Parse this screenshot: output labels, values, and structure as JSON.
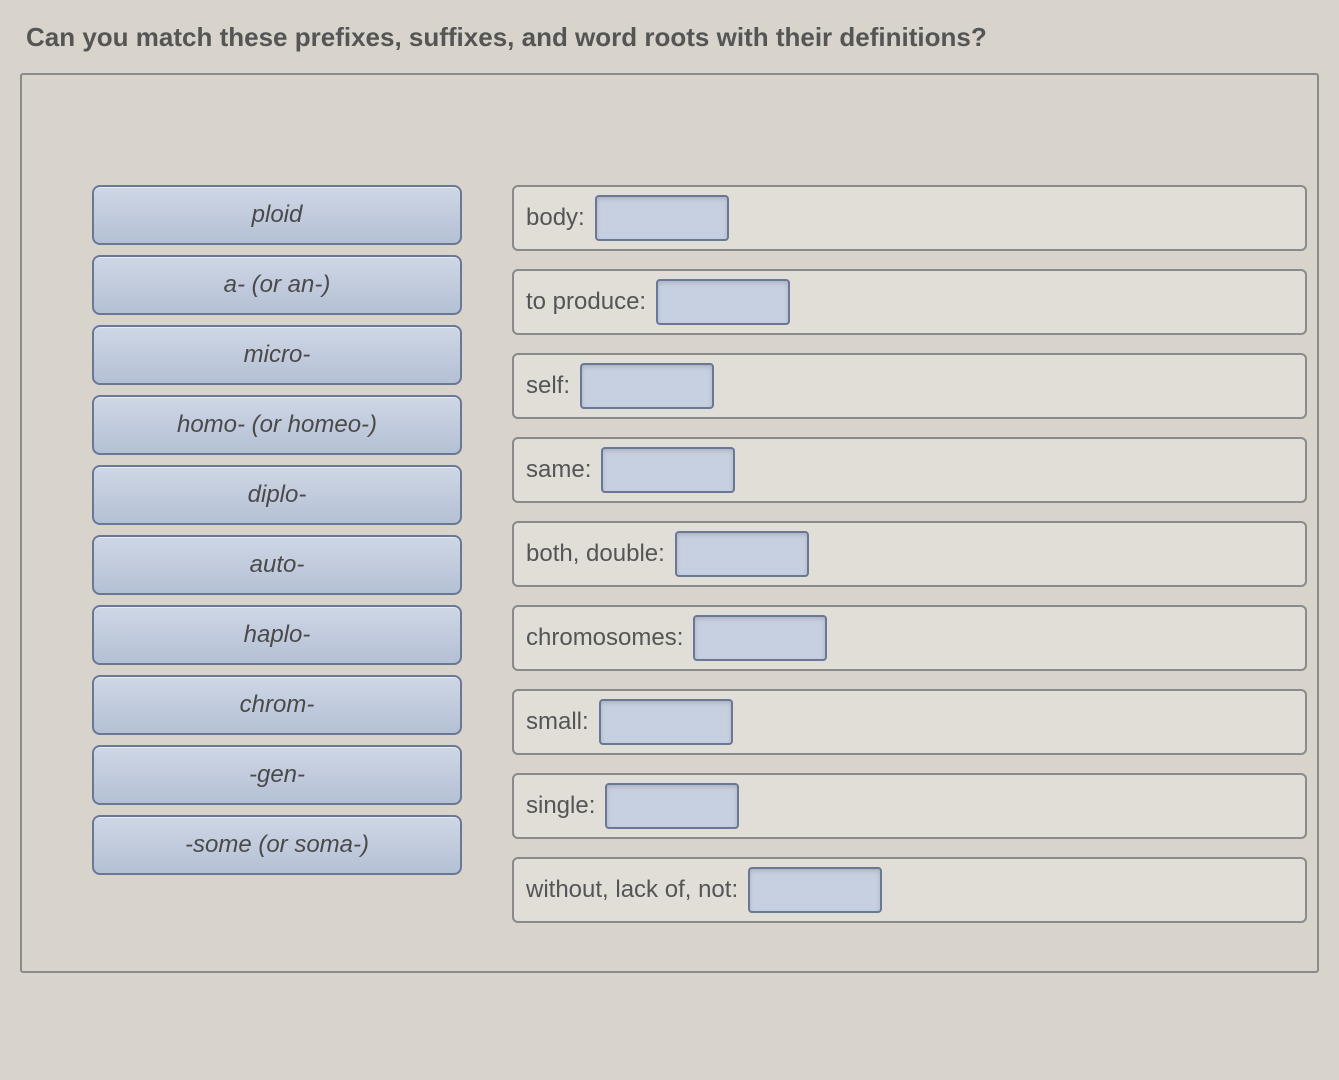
{
  "question": "Can you match these prefixes, suffixes, and word roots with their definitions?",
  "terms": [
    "ploid",
    "a- (or an-)",
    "micro-",
    "homo- (or homeo-)",
    "diplo-",
    "auto-",
    "haplo-",
    "chrom-",
    "-gen-",
    "-some (or soma-)"
  ],
  "definitions": [
    {
      "label": "body:"
    },
    {
      "label": "to produce:"
    },
    {
      "label": "self:"
    },
    {
      "label": "same:"
    },
    {
      "label": "both, double:"
    },
    {
      "label": "chromosomes:"
    },
    {
      "label": "small:"
    },
    {
      "label": "single:"
    },
    {
      "label": "without, lack of, not:"
    }
  ]
}
